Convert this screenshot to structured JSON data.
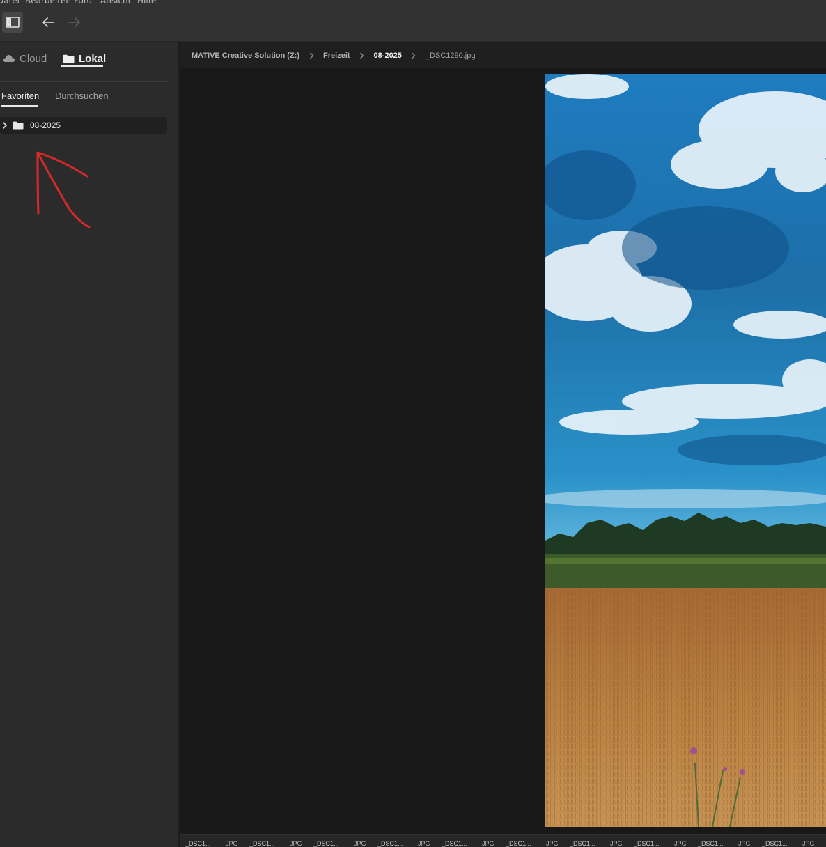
{
  "menu": [
    "Datei",
    "Bearbeiten",
    "Foto",
    "Ansicht",
    "Hilfe"
  ],
  "toolbar": {
    "panel_icon": "sidebar-toggle-icon",
    "back_icon": "arrow-left-icon",
    "forward_icon": "arrow-right-icon"
  },
  "sidebar": {
    "source_tabs": [
      {
        "label": "Cloud",
        "icon": "cloud-icon",
        "active": false
      },
      {
        "label": "Lokal",
        "icon": "folder-icon",
        "active": true
      }
    ],
    "sub_tabs": [
      {
        "label": "Favoriten",
        "active": true
      },
      {
        "label": "Durchsuchen",
        "active": false
      }
    ],
    "folders": [
      {
        "name": "08-2025",
        "expanded": false
      }
    ]
  },
  "breadcrumb": {
    "items": [
      "MATIVE Creative Solution (Z:)",
      "Freizeit",
      "08-2025",
      "_DSC1290.jpg"
    ]
  },
  "viewer": {
    "image_name": "_DSC1290.jpg"
  },
  "filmstrip": {
    "items": [
      {
        "name": "_DSC1...",
        "type": "JPG"
      },
      {
        "name": "_DSC1...",
        "type": "JPG"
      },
      {
        "name": "_DSC1...",
        "type": "JPG"
      },
      {
        "name": "_DSC1...",
        "type": "JPG"
      },
      {
        "name": "_DSC1...",
        "type": "JPG"
      },
      {
        "name": "_DSC1...",
        "type": "JPG"
      },
      {
        "name": "_DSC1...",
        "type": "JPG"
      },
      {
        "name": "_DSC1...",
        "type": "JPG"
      },
      {
        "name": "_DSC1...",
        "type": "JPG"
      },
      {
        "name": "_DSC1...",
        "type": "JPG"
      }
    ]
  },
  "colors": {
    "annotation": "#d42a2a",
    "sky": "#1f8ac9",
    "field": "#b87a3a"
  }
}
